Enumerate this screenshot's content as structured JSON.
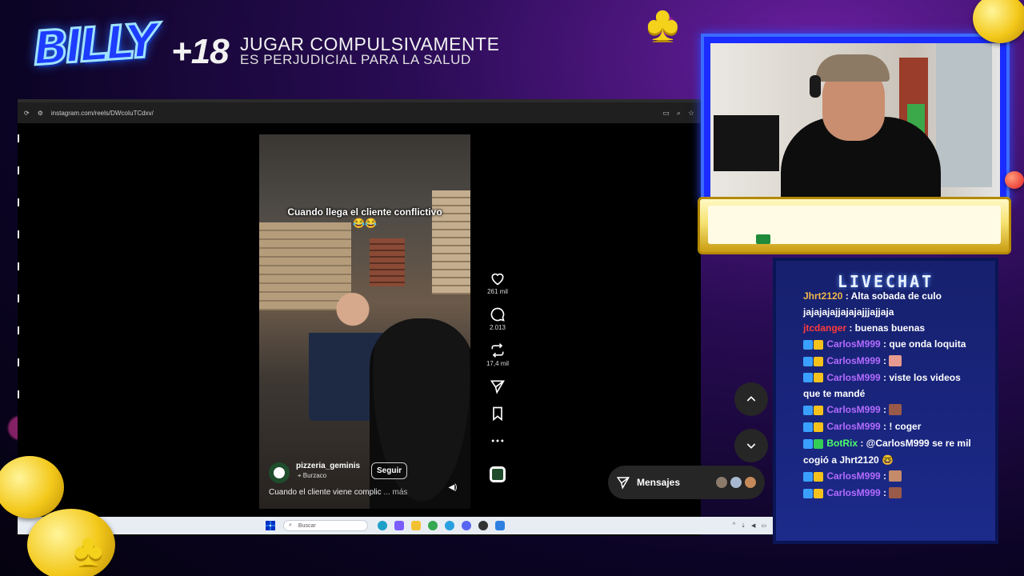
{
  "overlay": {
    "logo": "BILLY",
    "age": "+18",
    "warning_line1": "JUGAR COMPULSIVAMENTE",
    "warning_line2": "ES PERJUDICIAL PARA LA SALUD"
  },
  "browser": {
    "url": "instagram.com/reels/DWcoIuTCdxv/"
  },
  "reel": {
    "caption": "Cuando llega el cliente conflictivo",
    "caption_emoji": "😂😂",
    "author": "pizzeria_geminis",
    "location": "Burzaco",
    "follow_label": "Seguir",
    "description": "Cuando el cliente viene complic",
    "more_label": "... más"
  },
  "actions": {
    "likes": "261 mil",
    "comments": "2.013",
    "reposts": "17,4 mil"
  },
  "messages": {
    "label": "Mensajes"
  },
  "taskbar": {
    "search_placeholder": "Buscar"
  },
  "chat": {
    "title": "LIVECHAT",
    "messages": [
      {
        "user": "Jhrt2120",
        "user_color": "#f0b84a",
        "text": " : Alta sobada de culo jajajajajjajajajjjajjaja",
        "badges": [],
        "emote": ""
      },
      {
        "user": "jtcdanger",
        "user_color": "#ff3b3b",
        "text": " : buenas buenas",
        "badges": [],
        "emote": ""
      },
      {
        "user": "CarlosM999",
        "user_color": "#b36bff",
        "text": " : que onda loquita",
        "badges": [
          "#3aa0ff",
          "#f5c21c"
        ],
        "emote": ""
      },
      {
        "user": "CarlosM999",
        "user_color": "#b36bff",
        "text": " : ",
        "badges": [
          "#3aa0ff",
          "#f5c21c"
        ],
        "emote": "#e79a8f"
      },
      {
        "user": "CarlosM999",
        "user_color": "#b36bff",
        "text": " : viste los videos que te mandé",
        "badges": [
          "#3aa0ff",
          "#f5c21c"
        ],
        "emote": ""
      },
      {
        "user": "CarlosM999",
        "user_color": "#b36bff",
        "text": " : ",
        "badges": [
          "#3aa0ff",
          "#f5c21c"
        ],
        "emote": "#9a5a4a"
      },
      {
        "user": "CarlosM999",
        "user_color": "#b36bff",
        "text": " : ! coger",
        "badges": [
          "#3aa0ff",
          "#f5c21c"
        ],
        "emote": ""
      },
      {
        "user": "BotRix",
        "user_color": "#4dff6a",
        "text": " : @CarlosM999 se re mil cogió a Jhrt2120 🤓",
        "badges": [
          "#3aa0ff",
          "#33cc55"
        ],
        "emote": ""
      },
      {
        "user": "CarlosM999",
        "user_color": "#b36bff",
        "text": " : ",
        "badges": [
          "#3aa0ff",
          "#f5c21c"
        ],
        "emote": "#c48a6a"
      },
      {
        "user": "CarlosM999",
        "user_color": "#b36bff",
        "text": " : ",
        "badges": [
          "#3aa0ff",
          "#f5c21c"
        ],
        "emote": "#9a5a4a"
      }
    ]
  },
  "colors": {
    "accent_blue": "#1a2cff",
    "gold": "#f3c81a",
    "chat_bg": "#16206d"
  }
}
